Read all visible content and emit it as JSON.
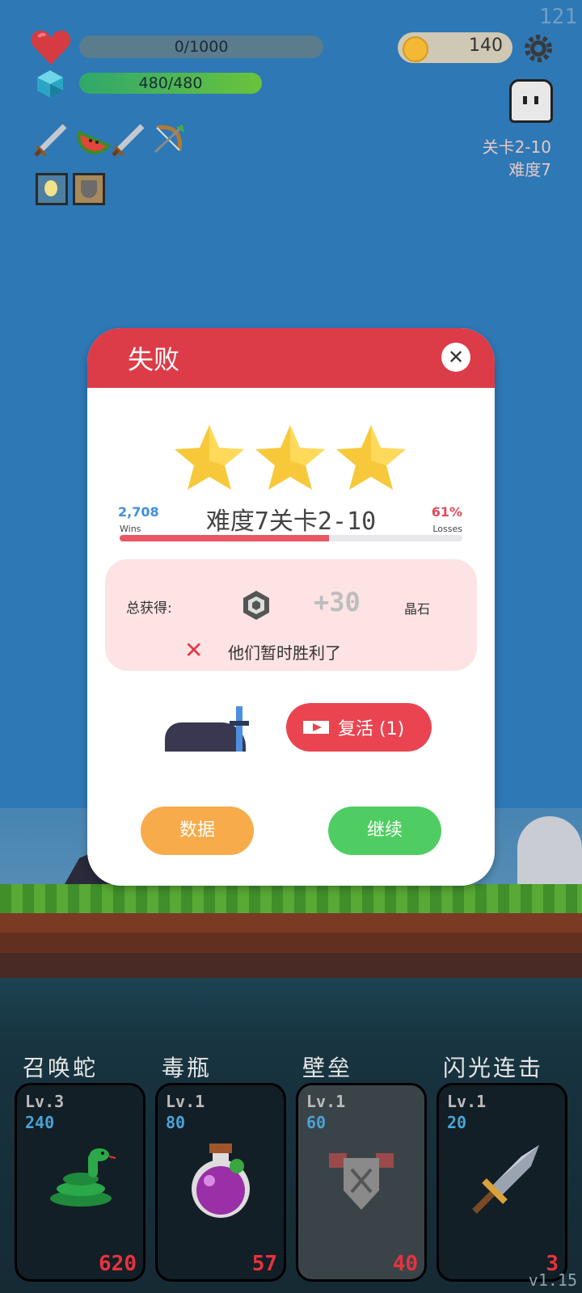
{
  "fps": "121",
  "hud": {
    "hp_text": "0/1000",
    "hp_fraction": 0,
    "mana_text": "480/480",
    "mana_fraction": 1,
    "coins": "140",
    "stage_line": "关卡2-10",
    "difficulty_line": "难度7",
    "items": [
      "sword-icon",
      "watermelon-icon",
      "sword-icon",
      "bow-icon"
    ],
    "buffs": [
      "light-buff-icon",
      "shield-buff-icon"
    ]
  },
  "dialog": {
    "title": "失败",
    "stars": 3,
    "wins_value": "2,708",
    "wins_label": "Wins",
    "losses_value": "61%",
    "losses_label": "Losses",
    "stage_title": "难度7关卡2-10",
    "progress_fraction": 0.61,
    "reward_label": "总获得:",
    "reward_amount": "+30",
    "reward_unit": "晶石",
    "fail_message": "他们暂时胜利了",
    "revive_label": "复活 (1)",
    "data_button": "数据",
    "continue_button": "继续"
  },
  "skills": [
    {
      "name": "召唤蛇",
      "level": "Lv.3",
      "cost": "240",
      "count": "620",
      "icon": "snake-icon",
      "dim": false
    },
    {
      "name": "毒瓶",
      "level": "Lv.1",
      "cost": "80",
      "count": "57",
      "icon": "poison-bottle-icon",
      "dim": false
    },
    {
      "name": "壁垒",
      "level": "Lv.1",
      "cost": "60",
      "count": "40",
      "icon": "armor-icon",
      "dim": true
    },
    {
      "name": "闪光连击",
      "level": "Lv.1",
      "cost": "20",
      "count": "3",
      "icon": "dagger-icon",
      "dim": false
    }
  ],
  "version": "v1.15",
  "colors": {
    "accent_red": "#dc3c48",
    "continue_green": "#4fcd62",
    "data_orange": "#f7ab4a"
  }
}
